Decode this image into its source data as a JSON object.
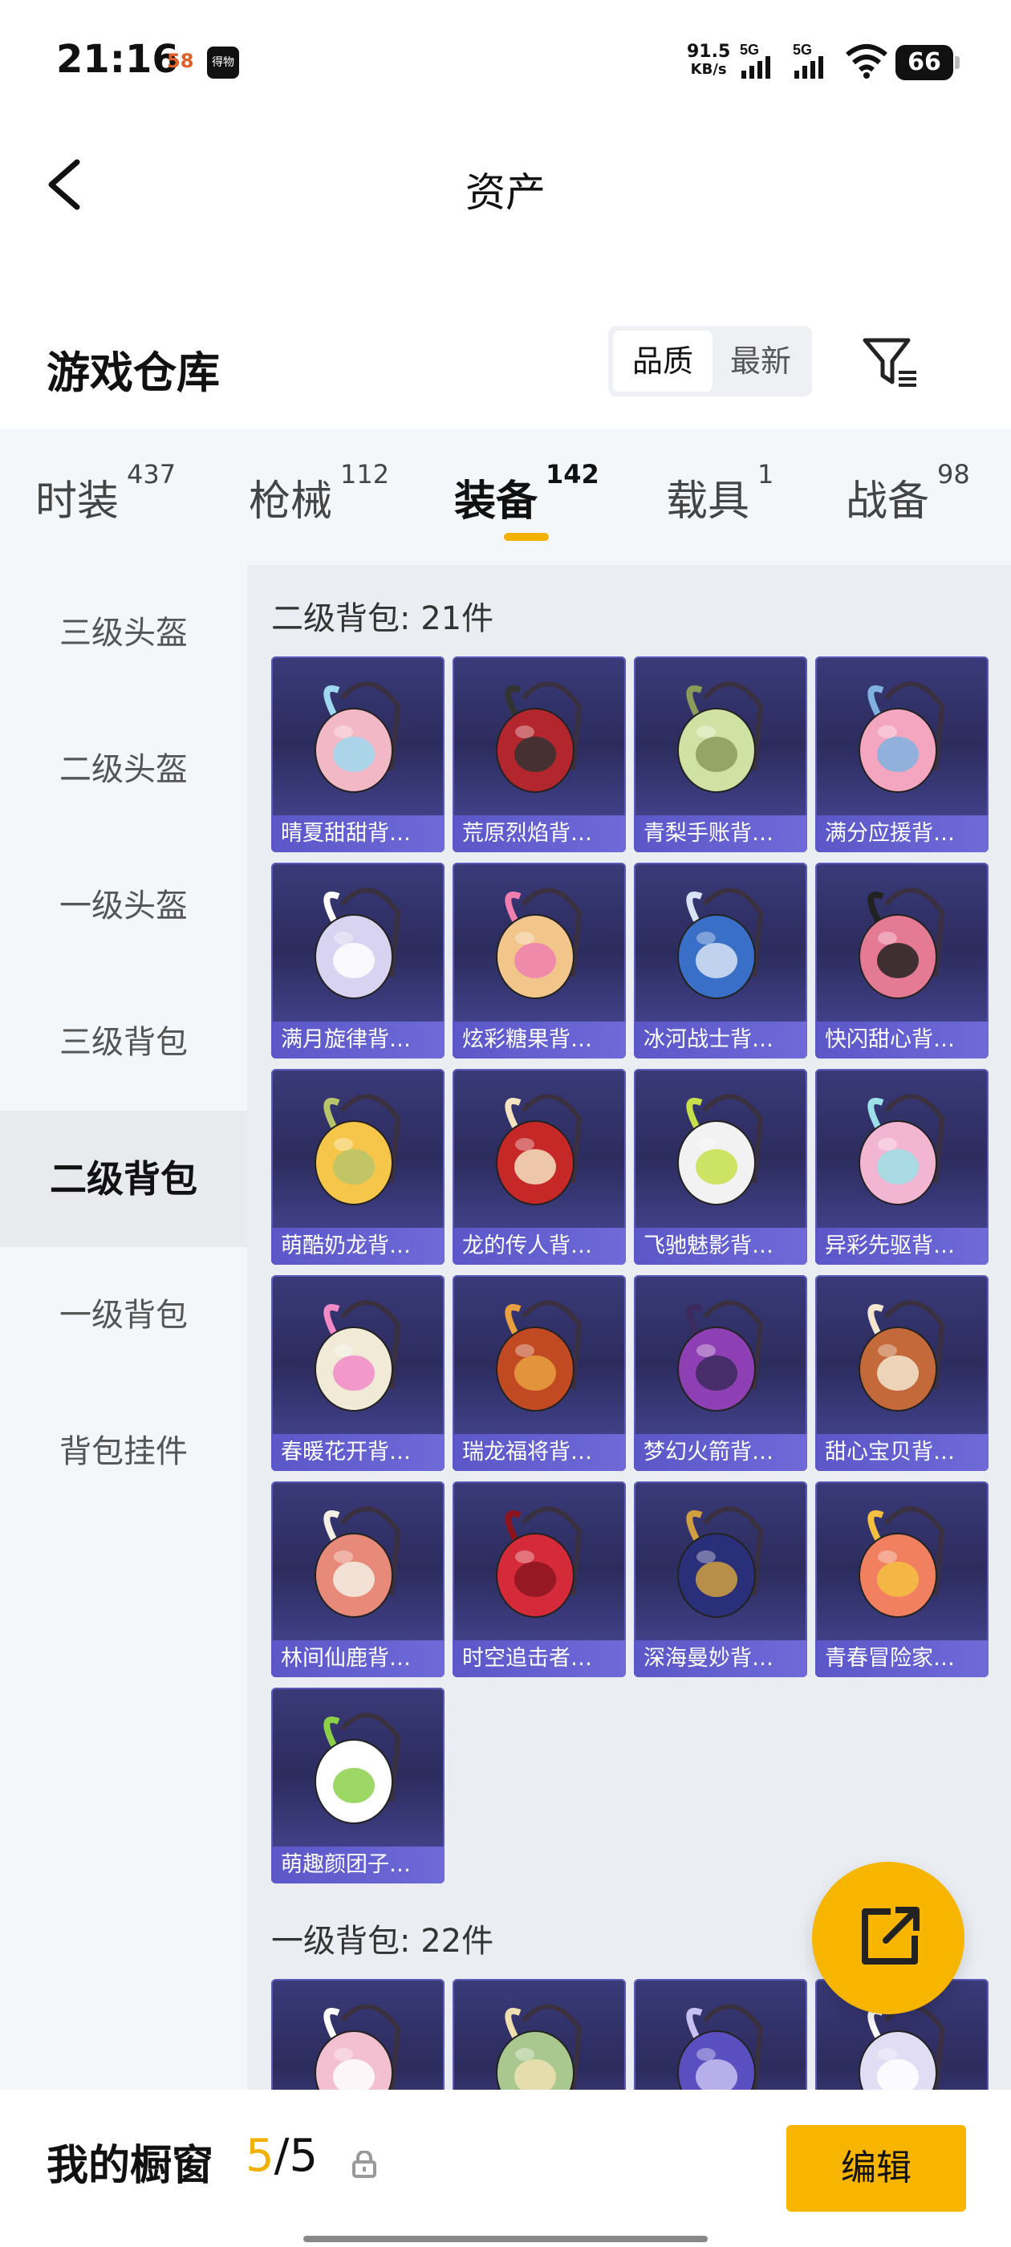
{
  "status_bar": {
    "time": "21:16",
    "app_badge_1": "58",
    "app_badge_2": "得物",
    "net_speed_value": "91.5",
    "net_speed_unit": "KB/s",
    "signal_1": "5G",
    "signal_2": "5G",
    "battery": "66"
  },
  "nav": {
    "title": "资产"
  },
  "warehouse": {
    "title": "游戏仓库",
    "sort_options": [
      "品质",
      "最新"
    ],
    "active_sort": "品质"
  },
  "tabs": [
    {
      "label": "时装",
      "count": "437"
    },
    {
      "label": "枪械",
      "count": "112"
    },
    {
      "label": "装备",
      "count": "142"
    },
    {
      "label": "载具",
      "count": "1"
    },
    {
      "label": "战备",
      "count": "98"
    }
  ],
  "active_tab": "装备",
  "sidebar": [
    "三级头盔",
    "二级头盔",
    "一级头盔",
    "三级背包",
    "二级背包",
    "一级背包",
    "背包挂件"
  ],
  "active_sidebar": "二级背包",
  "sections": [
    {
      "title": "二级背包: 21件",
      "items": [
        {
          "label": "晴夏甜甜背…",
          "color": "#f2b8c6",
          "accent": "#a0d8ef"
        },
        {
          "label": "荒原烈焰背…",
          "color": "#b3262e",
          "accent": "#333333"
        },
        {
          "label": "青梨手账背…",
          "color": "#cfe2a3",
          "accent": "#8a9b5a"
        },
        {
          "label": "满分应援背…",
          "color": "#f4a6c0",
          "accent": "#7fb2e0"
        },
        {
          "label": "满月旋律背…",
          "color": "#d7d3f0",
          "accent": "#ffffff"
        },
        {
          "label": "炫彩糖果背…",
          "color": "#f2c58a",
          "accent": "#f07fb0"
        },
        {
          "label": "冰河战士背…",
          "color": "#3a6fc7",
          "accent": "#d8e4f5"
        },
        {
          "label": "快闪甜心背…",
          "color": "#e57a94",
          "accent": "#222222"
        },
        {
          "label": "萌酷奶龙背…",
          "color": "#f6c64a",
          "accent": "#b7c46a"
        },
        {
          "label": "龙的传人背…",
          "color": "#c62828",
          "accent": "#f4e3c1"
        },
        {
          "label": "飞驰魅影背…",
          "color": "#f2f2f2",
          "accent": "#c7e04a"
        },
        {
          "label": "异彩先驱背…",
          "color": "#f3b6d2",
          "accent": "#9ce0e8"
        },
        {
          "label": "春暖花开背…",
          "color": "#f0ead6",
          "accent": "#f28ac8"
        },
        {
          "label": "瑞龙福将背…",
          "color": "#c24a22",
          "accent": "#e8a040"
        },
        {
          "label": "梦幻火箭背…",
          "color": "#8e3fb3",
          "accent": "#3b2b5e"
        },
        {
          "label": "甜心宝贝背…",
          "color": "#c46a3a",
          "accent": "#f5e6d0"
        },
        {
          "label": "林间仙鹿背…",
          "color": "#e88a7a",
          "accent": "#f4f0e6"
        },
        {
          "label": "时空追击者…",
          "color": "#d42a3a",
          "accent": "#8a1520"
        },
        {
          "label": "深海曼妙背…",
          "color": "#2a2f7a",
          "accent": "#d0a040"
        },
        {
          "label": "青春冒险家…",
          "color": "#f08060",
          "accent": "#f5c040"
        },
        {
          "label": "萌趣颜团子…",
          "color": "#ffffff",
          "accent": "#8cd04a"
        }
      ]
    },
    {
      "title": "一级背包: 22件",
      "items": [
        {
          "label": "",
          "color": "#f2c0d0",
          "accent": "#ffffff"
        },
        {
          "label": "",
          "color": "#a8c890",
          "accent": "#f0e0b0"
        },
        {
          "label": "",
          "color": "#5a4fc0",
          "accent": "#c8c0f0"
        },
        {
          "label": "",
          "color": "#e0ddf5",
          "accent": "#ffffff"
        }
      ]
    }
  ],
  "fab": {
    "icon": "share-export-icon"
  },
  "bottom_bar": {
    "label": "我的橱窗",
    "count_current": "5",
    "count_total": "/5",
    "edit_label": "编辑"
  }
}
